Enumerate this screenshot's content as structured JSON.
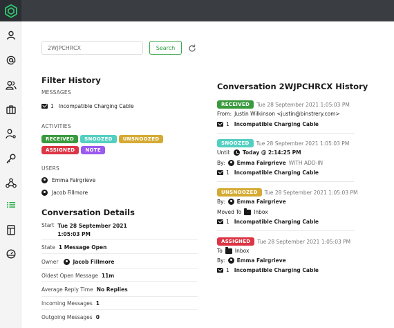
{
  "search": {
    "value": "2WJPCHRCX",
    "button": "Search"
  },
  "filter": {
    "title": "Filter History",
    "messages_label": "MESSAGES",
    "message": {
      "count": "1",
      "subject": "Incompatible Charging Cable"
    },
    "activities_label": "ACTIVITIES",
    "activities": [
      "RECEIVED",
      "SNOOZED",
      "UNSNOOZED",
      "ASSIGNED",
      "NOTE"
    ],
    "users_label": "USERS",
    "users": [
      "Emma Fairgrieve",
      "Jacob Fillmore"
    ]
  },
  "details": {
    "title": "Conversation Details",
    "start_label": "Start",
    "start_line1": "Tue 28 September 2021",
    "start_line2": "1:05:03 PM",
    "state_label": "State",
    "state_value": "1 Message Open",
    "owner_label": "Owner",
    "owner_value": "Jacob Fillmore",
    "oldest_label": "Oldest Open Message",
    "oldest_value": "11m",
    "reply_label": "Average Reply Time",
    "reply_value": "No Replies",
    "incoming_label": "Incoming Messages",
    "incoming_value": "1",
    "outgoing_label": "Outgoing Messages",
    "outgoing_value": "0"
  },
  "history": {
    "title": "Conversation 2WJPCHRCX History",
    "entries": [
      {
        "badge": "RECEIVED",
        "time": "Tue 28 September 2021 1:05:03 PM",
        "from_label": "From:",
        "from_value": "Justin Wilkinson <justin@binstrery.com>",
        "msg_count": "1",
        "msg_subject": "Incompatible Charging Cable"
      },
      {
        "badge": "SNOOZED",
        "time": "Tue 28 September 2021 1:05:03 PM",
        "until_label": "Until:",
        "until_value": "Today @ 2:14:25 PM",
        "by_label": "By:",
        "by_value": "Emma Fairgrieve",
        "by_suffix": "WITH ADD-IN",
        "msg_count": "1",
        "msg_subject": "Incompatible Charging Cable"
      },
      {
        "badge": "UNSNOOZED",
        "time": "Tue 28 September 2021 1:05:03 PM",
        "by_label": "By:",
        "by_value": "Emma Fairgrieve",
        "moved_label": "Moved To",
        "moved_value": "Inbox",
        "msg_count": "1",
        "msg_subject": "Incompatible Charging Cable"
      },
      {
        "badge": "ASSIGNED",
        "time": "Tue 28 September 2021 1:05:03 PM",
        "to_label": "To",
        "to_value": "Inbox",
        "by_label": "By:",
        "by_value": "Emma Fairgrieve",
        "msg_count": "1",
        "msg_subject": "Incompatible Charging Cable"
      }
    ]
  },
  "colors": {
    "received": "#3a9a3e",
    "snoozed": "#53cfc2",
    "unsnoozed": "#d5aa33",
    "assigned": "#dc3545",
    "note": "#9b59f0",
    "topbar": "#3a3d42",
    "logo": "#2ecc71"
  },
  "icons": [
    "logo-icon",
    "user-icon",
    "at-icon",
    "users-icon",
    "briefcase-icon",
    "user-settings-icon",
    "key-icon",
    "webhook-icon",
    "list-icon",
    "report-icon",
    "dashboard-icon",
    "refresh-icon"
  ]
}
